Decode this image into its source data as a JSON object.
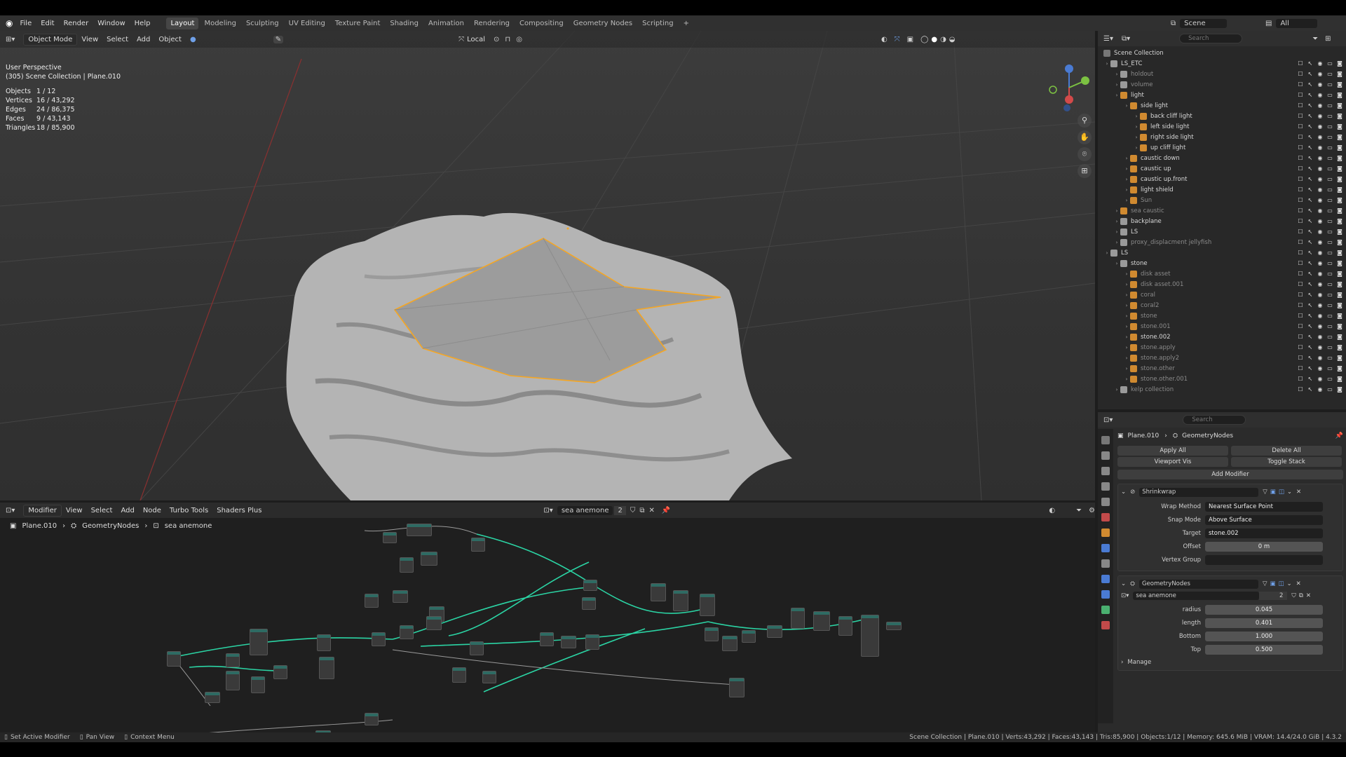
{
  "topbar": {
    "menu": [
      "File",
      "Edit",
      "Render",
      "Window",
      "Help"
    ],
    "workspaces": [
      "Layout",
      "Modeling",
      "Sculpting",
      "UV Editing",
      "Texture Paint",
      "Shading",
      "Animation",
      "Rendering",
      "Compositing",
      "Geometry Nodes",
      "Scripting"
    ],
    "active_workspace": "Layout",
    "add_tab": "+",
    "scene": "Scene",
    "view_layer": "All"
  },
  "viewport": {
    "mode": "Object Mode",
    "menus": [
      "View",
      "Select",
      "Add",
      "Object"
    ],
    "orientation": "Local",
    "perspective": "User Perspective",
    "collection": "(305) Scene Collection | Plane.010",
    "stats": [
      {
        "label": "Objects",
        "value": "1 / 12"
      },
      {
        "label": "Vertices",
        "value": "16 / 43,292"
      },
      {
        "label": "Edges",
        "value": "24 / 86,375"
      },
      {
        "label": "Faces",
        "value": "9 / 43,143"
      },
      {
        "label": "Triangles",
        "value": "18 / 85,900"
      }
    ]
  },
  "node_editor": {
    "editor": "Modifier",
    "menus": [
      "View",
      "Select",
      "Add",
      "Node",
      "Turbo Tools",
      "Shaders Plus"
    ],
    "tree_name": "sea anemone",
    "users": "2",
    "breadcrumb": [
      "Plane.010",
      "GeometryNodes",
      "sea anemone"
    ]
  },
  "outliner": {
    "search_placeholder": "Search",
    "root": "Scene Collection",
    "items": [
      {
        "name": "LS_ETC",
        "depth": 0,
        "dim": false
      },
      {
        "name": "holdout",
        "depth": 1,
        "dim": true
      },
      {
        "name": "volume",
        "depth": 1,
        "dim": true
      },
      {
        "name": "light",
        "depth": 1,
        "dim": false
      },
      {
        "name": "side light",
        "depth": 2,
        "dim": false
      },
      {
        "name": "back cliff light",
        "depth": 3,
        "dim": false
      },
      {
        "name": "left side light",
        "depth": 3,
        "dim": false
      },
      {
        "name": "right side light",
        "depth": 3,
        "dim": false
      },
      {
        "name": "up cliff light",
        "depth": 3,
        "dim": false
      },
      {
        "name": "caustic down",
        "depth": 2,
        "dim": false
      },
      {
        "name": "caustic up",
        "depth": 2,
        "dim": false
      },
      {
        "name": "caustic up.front",
        "depth": 2,
        "dim": false
      },
      {
        "name": "light shield",
        "depth": 2,
        "dim": false
      },
      {
        "name": "Sun",
        "depth": 2,
        "dim": true
      },
      {
        "name": "sea caustic",
        "depth": 1,
        "dim": true
      },
      {
        "name": "backplane",
        "depth": 1,
        "dim": false
      },
      {
        "name": "LS",
        "depth": 1,
        "dim": false
      },
      {
        "name": "proxy_displacment jellyfish",
        "depth": 1,
        "dim": true
      },
      {
        "name": "LS",
        "depth": 0,
        "dim": false
      },
      {
        "name": "stone",
        "depth": 1,
        "dim": false
      },
      {
        "name": "disk asset",
        "depth": 2,
        "dim": true
      },
      {
        "name": "disk asset.001",
        "depth": 2,
        "dim": true
      },
      {
        "name": "coral",
        "depth": 2,
        "dim": true
      },
      {
        "name": "coral2",
        "depth": 2,
        "dim": true
      },
      {
        "name": "stone",
        "depth": 2,
        "dim": true
      },
      {
        "name": "stone.001",
        "depth": 2,
        "dim": true
      },
      {
        "name": "stone.002",
        "depth": 2,
        "dim": false
      },
      {
        "name": "stone.apply",
        "depth": 2,
        "dim": true
      },
      {
        "name": "stone.apply2",
        "depth": 2,
        "dim": true
      },
      {
        "name": "stone.other",
        "depth": 2,
        "dim": true
      },
      {
        "name": "stone.other.001",
        "depth": 2,
        "dim": true
      },
      {
        "name": "kelp collection",
        "depth": 1,
        "dim": true
      }
    ]
  },
  "properties": {
    "search_placeholder": "Search",
    "object": "Plane.010",
    "modifier_path": "GeometryNodes",
    "apply_all": "Apply All",
    "delete_all": "Delete All",
    "viewport_vis": "Viewport Vis",
    "toggle_stack": "Toggle Stack",
    "add_modifier": "Add Modifier",
    "shrinkwrap": {
      "name": "Shrinkwrap",
      "fields": [
        {
          "label": "Wrap Method",
          "value": "Nearest Surface Point",
          "kind": "select"
        },
        {
          "label": "Snap Mode",
          "value": "Above Surface",
          "kind": "select"
        },
        {
          "label": "Target",
          "value": "stone.002",
          "kind": "obj"
        },
        {
          "label": "Offset",
          "value": "0 m",
          "kind": "num"
        },
        {
          "label": "Vertex Group",
          "value": "",
          "kind": "obj"
        }
      ]
    },
    "geonodes": {
      "name": "GeometryNodes",
      "tree": "sea anemone",
      "users": "2",
      "fields": [
        {
          "label": "radius",
          "value": "0.045"
        },
        {
          "label": "length",
          "value": "0.401"
        },
        {
          "label": "Bottom",
          "value": "1.000"
        },
        {
          "label": "Top",
          "value": "0.500"
        }
      ],
      "manage": "Manage"
    }
  },
  "statusbar": {
    "left": [
      "Set Active Modifier",
      "Pan View",
      "Context Menu"
    ],
    "right": "Scene Collection | Plane.010 | Verts:43,292 | Faces:43,143 | Tris:85,900 | Objects:1/12 | Memory: 645.6 MiB | VRAM: 14.4/24.0 GiB | 4.3.2"
  },
  "colors": {
    "accent": "#4772b3",
    "selection": "#f5a623",
    "wire": "#2bd4a4"
  }
}
